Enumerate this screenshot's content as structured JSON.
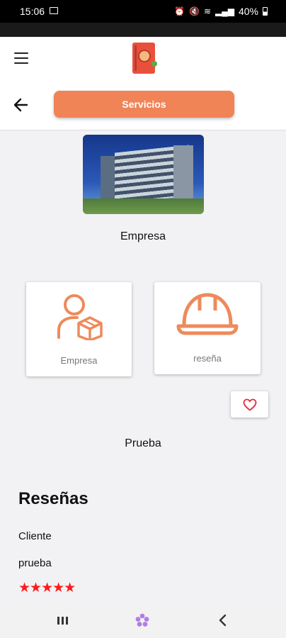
{
  "status_bar": {
    "time": "15:06",
    "icons": [
      "image-icon",
      "alarm-icon",
      "mute-icon",
      "wifi-icon",
      "signal-icon"
    ],
    "battery": "40%"
  },
  "header": {
    "menu_icon": "hamburger-menu-icon",
    "logo_icon": "app-logo-icon",
    "back_icon": "arrow-left-icon",
    "services_label": "Servicios"
  },
  "company": {
    "image": "office-building-photo",
    "name": "Empresa"
  },
  "cards": [
    {
      "icon": "person-package-icon",
      "label": "Empresa"
    },
    {
      "icon": "hard-hat-icon",
      "label": "reseña"
    }
  ],
  "favorite": {
    "icon": "heart-outline-icon"
  },
  "description": "Prueba",
  "reviews": {
    "title": "Reseñas",
    "items": [
      {
        "client": "Cliente",
        "text": "prueba",
        "rating": 5,
        "stars": "★★★★★"
      }
    ]
  },
  "nav_bar": {
    "icons": [
      "recents-icon",
      "home-icon",
      "back-icon"
    ]
  },
  "colors": {
    "accent": "#f08457",
    "icon_orange": "#ee8a5c",
    "star_red": "#ff1a1a",
    "background": "#f2f2f4"
  }
}
